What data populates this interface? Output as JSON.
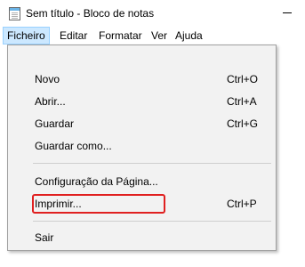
{
  "window": {
    "title": "Sem título - Bloco de notas",
    "icon": "notepad-icon"
  },
  "menubar": {
    "items": [
      {
        "label": "Ficheiro",
        "active": true
      },
      {
        "label": "Editar"
      },
      {
        "label": "Formatar"
      },
      {
        "label": "Ver"
      },
      {
        "label": "Ajuda"
      }
    ]
  },
  "file_menu": {
    "items": [
      {
        "label": "Novo",
        "shortcut": "Ctrl+O"
      },
      {
        "label": "Abrir...",
        "shortcut": "Ctrl+A"
      },
      {
        "label": "Guardar",
        "shortcut": "Ctrl+G"
      },
      {
        "label": "Guardar como...",
        "shortcut": ""
      },
      {
        "label": "Configuração da Página...",
        "shortcut": ""
      },
      {
        "label": "Imprimir...",
        "shortcut": "Ctrl+P",
        "highlighted": true
      },
      {
        "label": "Sair",
        "shortcut": ""
      }
    ]
  },
  "colors": {
    "menubar_active_bg": "#cce8ff",
    "highlight_box": "#e02020",
    "menu_bg": "#f2f2f2"
  }
}
